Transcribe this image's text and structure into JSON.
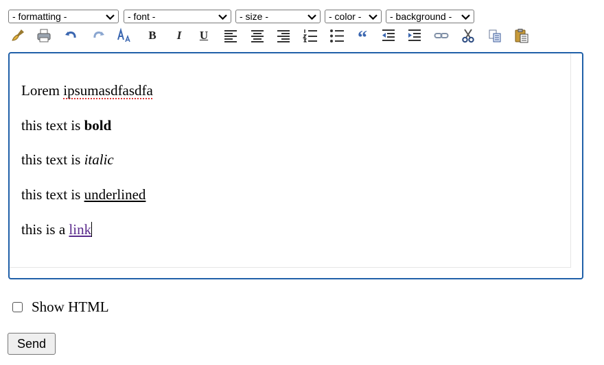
{
  "selects": [
    {
      "name": "formatting-select",
      "value": "- formatting -"
    },
    {
      "name": "font-select",
      "value": "- font -"
    },
    {
      "name": "size-select",
      "value": "- size -"
    },
    {
      "name": "color-select",
      "value": "- color -"
    },
    {
      "name": "background-select",
      "value": "- background -"
    }
  ],
  "toolbar": {
    "icons": [
      "clean-icon",
      "print-icon",
      "undo-icon",
      "redo-icon",
      "font-size-icon",
      "bold-icon",
      "italic-icon",
      "underline-icon",
      "align-left-icon",
      "align-center-icon",
      "align-right-icon",
      "ordered-list-icon",
      "unordered-list-icon",
      "quote-icon",
      "outdent-icon",
      "indent-icon",
      "link-icon",
      "cut-icon",
      "copy-icon",
      "paste-icon"
    ],
    "bold_glyph": "B",
    "italic_glyph": "I",
    "underline_glyph": "U",
    "quote_glyph": "“"
  },
  "editor": {
    "p1_prefix": "Lorem ",
    "p1_misspelled": "ipsumasdfasdfa",
    "p2_prefix": "this text is ",
    "p2_bold": "bold",
    "p3_prefix": "this text is ",
    "p3_italic": "italic",
    "p4_prefix": "this text is ",
    "p4_underlined": "underlined",
    "p5_prefix": "this is a ",
    "p5_link": "link"
  },
  "show_html": {
    "label": "Show HTML",
    "checked": false
  },
  "send_label": "Send",
  "colors": {
    "editor_border": "#1f5fa8",
    "link": "#5a2a8c",
    "spellcheck": "#dd3333"
  }
}
